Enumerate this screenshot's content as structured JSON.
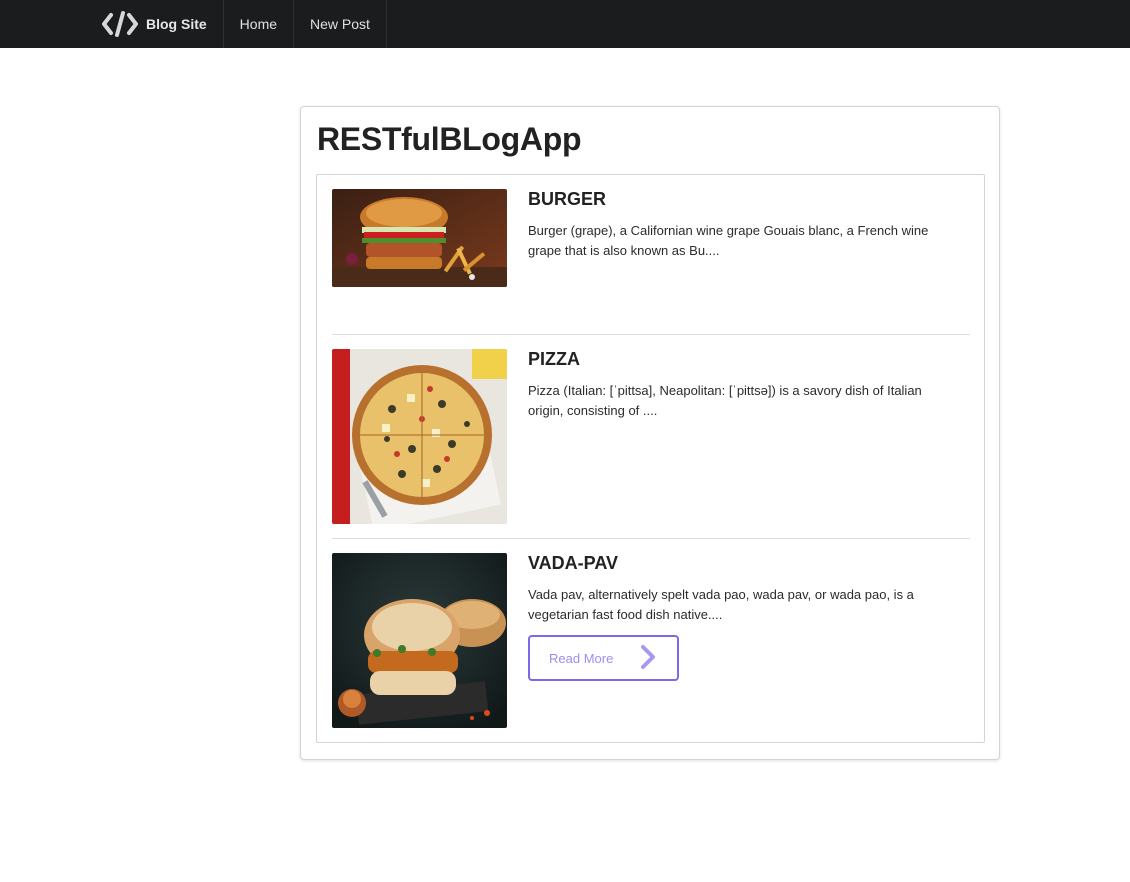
{
  "navbar": {
    "brand_icon": "code-brackets-icon",
    "brand_label": "Blog Site",
    "links": [
      "Home",
      "New Post"
    ]
  },
  "page": {
    "title": "RESTfulBLogApp"
  },
  "posts": [
    {
      "title": "BURGER",
      "excerpt": "Burger (grape), a Californian wine grape Gouais blanc, a French wine grape that is also known as Bu....",
      "image": "burger-photo"
    },
    {
      "title": "PIZZA",
      "excerpt": "Pizza (Italian: [ˈpittsa], Neapolitan: [ˈpittsə]) is a savory dish of Italian origin, consisting of ....",
      "image": "pizza-photo"
    },
    {
      "title": "VADA-PAV",
      "excerpt": "Vada pav, alternatively spelt vada pao, wada pav, or wada pao, is a vegetarian fast food dish native....",
      "image": "vada-pav-photo",
      "button_label": "Read More",
      "button_icon": "chevron-right-icon"
    }
  ],
  "colors": {
    "navbar_bg": "#1b1c1d",
    "button_accent": "#7b68ee"
  }
}
